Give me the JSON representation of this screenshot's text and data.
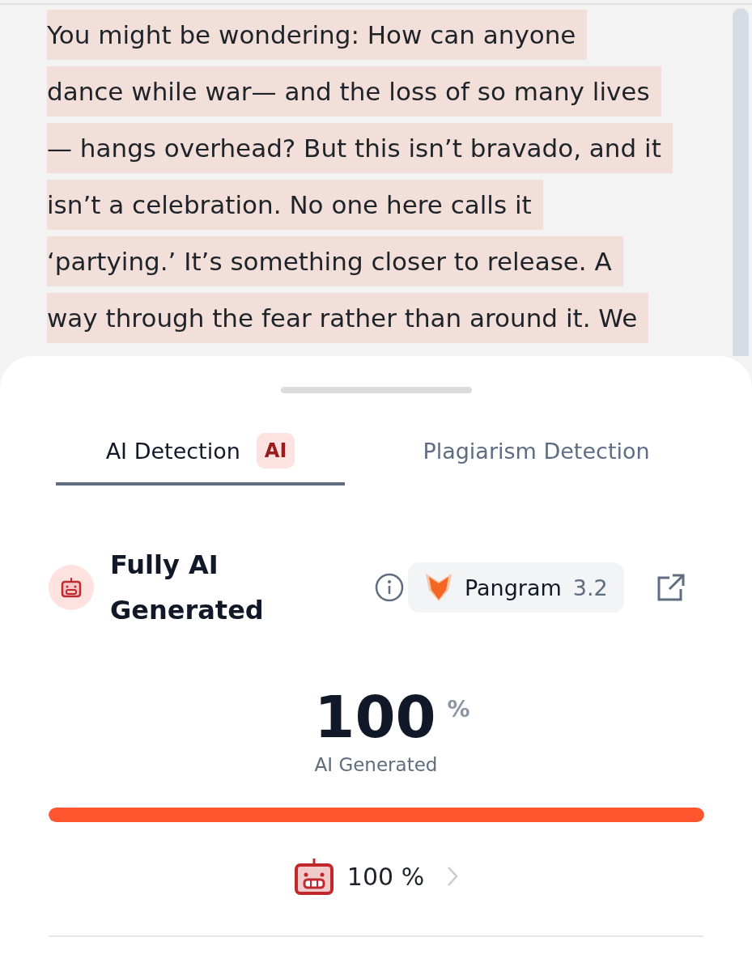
{
  "article": {
    "lines": [
      "You might be wondering: How can anyone",
      "dance while war— and the loss of so many lives",
      "— hangs overhead? But this isn’t bravado, and it",
      "isn’t a celebration. No one here calls it",
      "‘partying.’ It’s something closer to release. A",
      "way through the fear rather than around it. We"
    ]
  },
  "tabs": [
    {
      "label": "AI Detection",
      "badge": "AI",
      "selected": true
    },
    {
      "label": "Plagiarism Detection",
      "selected": false
    }
  ],
  "result": {
    "title": "Fully AI Generated",
    "detector": {
      "name": "Pangram",
      "version": "3.2"
    }
  },
  "score": {
    "value": "100",
    "unit": "%",
    "caption": "AI Generated",
    "level": 1.0
  },
  "summary": {
    "value": "100 %"
  }
}
